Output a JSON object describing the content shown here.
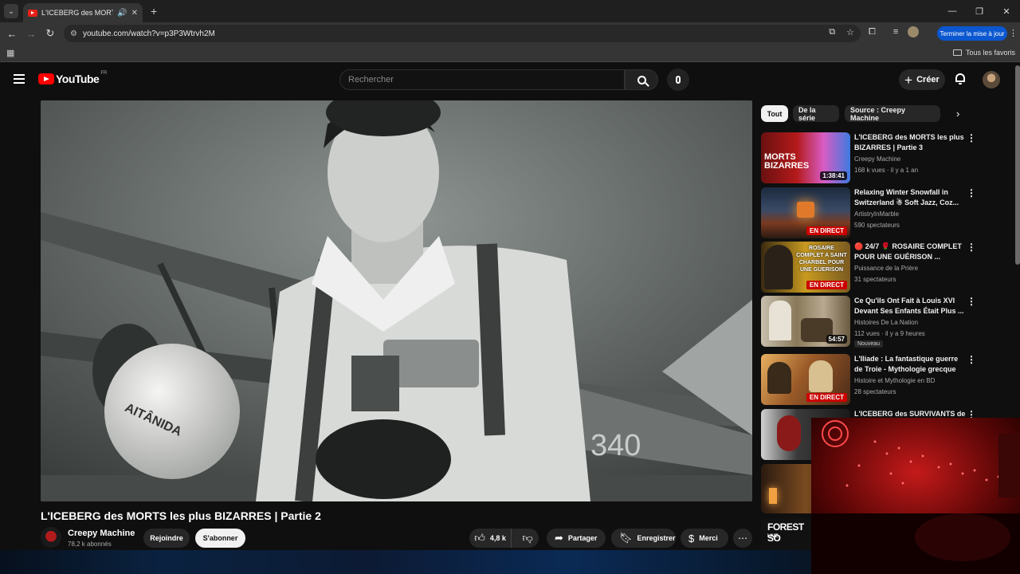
{
  "browser": {
    "tab_title": "L'ICEBERG des MORTS les p",
    "url": "youtube.com/watch?v=p3P3Wtrvh2M",
    "update_label": "Terminer la mise à jour",
    "bookmarks_label": "Tous les favoris"
  },
  "youtube": {
    "logo_text": "YouTube",
    "country_code": "FR",
    "search_placeholder": "Rechercher",
    "create_label": "Créer"
  },
  "video": {
    "title": "L'ICEBERG des MORTS les plus BIZARRES | Partie 2",
    "channel": "Creepy Machine",
    "subscribers": "78,2 k abonnés",
    "join_label": "Rejoindre",
    "subscribe_label": "S'abonner",
    "likes": "4,8 k",
    "share_label": "Partager",
    "save_label": "Enregistrer",
    "thanks_label": "Merci",
    "frame_text": {
      "helmet_text": "AITÂNIDA",
      "plane_number": "340"
    }
  },
  "chips": [
    "Tout",
    "De la série",
    "Source : Creepy Machine"
  ],
  "recommendations": [
    {
      "title": "L'ICEBERG des MORTS les plus BIZARRES | Partie 3",
      "channel": "Creepy Machine",
      "meta": "168 k vues · il y a 1 an",
      "duration": "1:38:41",
      "live": "",
      "badge": "",
      "thumb_text": "MORTS BIZARRES"
    },
    {
      "title": "Relaxing Winter Snowfall in Switzerland ☃ Soft Jazz, Coz...",
      "channel": "ArtistryInMarble",
      "meta": "590 spectateurs",
      "duration": "",
      "live": "EN DIRECT",
      "badge": "",
      "thumb_text": ""
    },
    {
      "title": "🔴 24/7 🌹 ROSAIRE COMPLET POUR UNE GUÉRISON ...",
      "channel": "Puissance de la Prière",
      "meta": "31 spectateurs",
      "duration": "",
      "live": "EN DIRECT",
      "badge": "",
      "thumb_text": "ROSAIRE COMPLET A SAINT CHARBEL POUR UNE GUERISON"
    },
    {
      "title": "Ce Qu'ils Ont Fait à Louis XVI Devant Ses Enfants Était Plus ...",
      "channel": "Histoires De La Nation",
      "meta": "112 vues · il y a 9 heures",
      "duration": "54:57",
      "live": "",
      "badge": "Nouveau",
      "thumb_text": ""
    },
    {
      "title": "L'Iliade : La fantastique guerre de Troie - Mythologie grecque",
      "channel": "Histoire et Mythologie en BD",
      "meta": "28 spectateurs",
      "duration": "",
      "live": "EN DIRECT",
      "badge": "",
      "thumb_text": ""
    },
    {
      "title": "L'ICEBERG des SURVIVANTS de",
      "channel": "",
      "meta": "",
      "duration": "",
      "live": "",
      "badge": "",
      "thumb_text": ""
    }
  ],
  "forest_thumb": {
    "title": "FOREST SO",
    "live": "LIVE"
  },
  "colors": {
    "background": "#0f0f0f",
    "accent_red": "#ff0000",
    "live_red": "#cc0000",
    "update_blue": "#0b57d0"
  }
}
